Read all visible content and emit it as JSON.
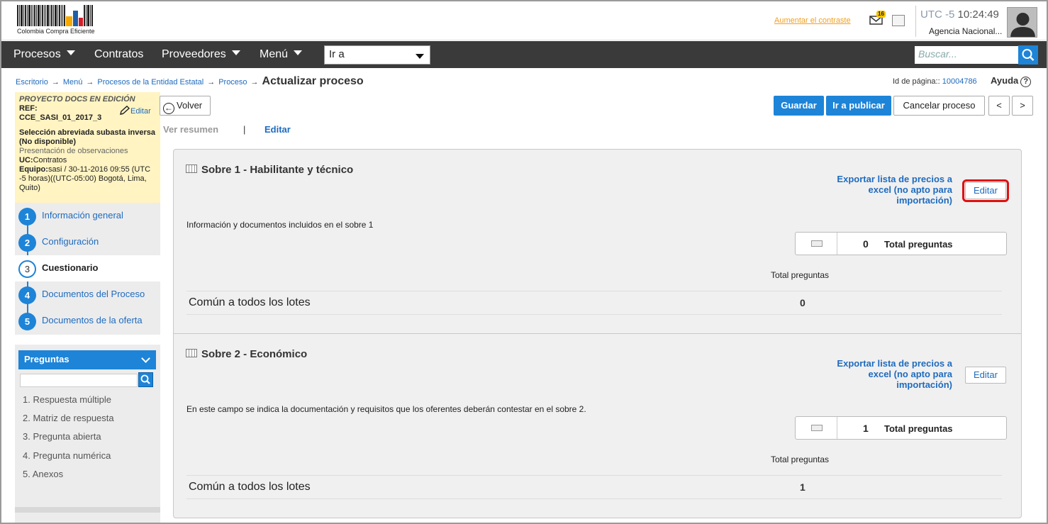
{
  "header": {
    "logo_text": "Colombia Compra Eficiente",
    "contrast_link": "Aumentar el contraste",
    "mail_badge": "16",
    "utc_label": "UTC -5",
    "time": "10:24:49",
    "agency": "Agencia Nacional..."
  },
  "nav": {
    "items": [
      "Procesos",
      "Contratos",
      "Proveedores",
      "Menú"
    ],
    "goto_value": "Ir a",
    "search_placeholder": "Buscar..."
  },
  "breadcrumb": {
    "items": [
      "Escritorio",
      "Menú",
      "Procesos de la Entidad Estatal",
      "Proceso"
    ],
    "current": "Actualizar proceso"
  },
  "page_id": {
    "label": "Id de página::",
    "value": "10004786"
  },
  "help_label": "Ayuda",
  "project": {
    "title": "PROYECTO DOCS EN EDICIÓN",
    "ref": "REF: CCE_SASI_01_2017_3",
    "edit_label": "Editar",
    "type": "Selección abreviada subasta inversa (No disponible)",
    "phase": "Presentación de observaciones",
    "uc_label": "UC:",
    "uc_value": "Contratos",
    "team_label": "Equipo:",
    "team_value": "sasi / 30-11-2016 09:55 (UTC -5 horas)((UTC-05:00) Bogotá, Lima, Quito)"
  },
  "steps": [
    {
      "num": "1",
      "label": "Información general"
    },
    {
      "num": "2",
      "label": "Configuración"
    },
    {
      "num": "3",
      "label": "Cuestionario"
    },
    {
      "num": "4",
      "label": "Documentos del Proceso"
    },
    {
      "num": "5",
      "label": "Documentos de la oferta"
    }
  ],
  "active_step": "3",
  "preguntas": {
    "title": "Preguntas",
    "items": [
      "1. Respuesta múltiple",
      "2. Matriz de respuesta",
      "3. Pregunta abierta",
      "4. Pregunta numérica",
      "5. Anexos"
    ]
  },
  "toolbar": {
    "back_label": "Volver",
    "save_label": "Guardar",
    "publish_label": "Ir a publicar",
    "cancel_label": "Cancelar proceso",
    "prev_label": "<",
    "next_label": ">"
  },
  "view_tabs": {
    "summary": "Ver resumen",
    "separator": "|",
    "edit": "Editar"
  },
  "sobres": [
    {
      "title": "Sobre 1 - Habilitante y técnico",
      "export_label": "Exportar lista de precios a excel (no apto para importación)",
      "edit_label": "Editar",
      "description": "Información y documentos incluidos en el sobre 1",
      "total_count": "0",
      "total_label": "Total preguntas",
      "column_header": "Total preguntas",
      "row_label": "Común a todos los lotes",
      "row_value": "0"
    },
    {
      "title": "Sobre 2 - Económico",
      "export_label": "Exportar lista de precios a excel (no apto para importación)",
      "edit_label": "Editar",
      "description": "En este campo se indica la documentación y requisitos que los oferentes deberán contestar en el sobre 2.",
      "total_count": "1",
      "total_label": "Total preguntas",
      "column_header": "Total preguntas",
      "row_label": "Común a todos los lotes",
      "row_value": "1"
    }
  ],
  "colors": {
    "primary": "#1d84d8",
    "nav_bg": "#3a3a3a",
    "highlight": "#e01010",
    "project_bg": "#fff4c2"
  }
}
